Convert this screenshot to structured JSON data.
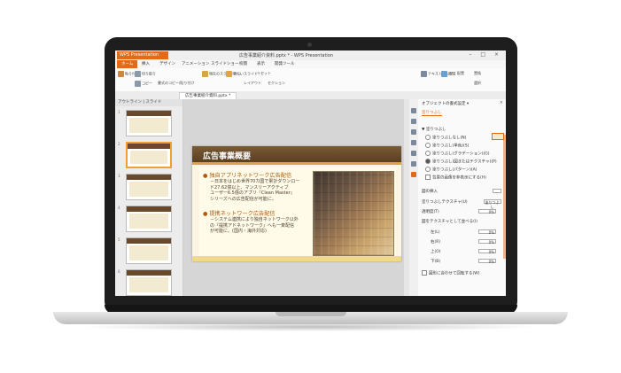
{
  "app": {
    "menu_button": "WPS Presentation",
    "doc_title": "広告事業紹介資料.pptx * - WPS Presentation",
    "window_controls": "– □ ×"
  },
  "menu": {
    "items": [
      "ホーム",
      "挿入",
      "デザイン",
      "アニメーション",
      "スライドショー",
      "校閲",
      "表示",
      "開発ツール"
    ],
    "active_index": 0
  },
  "ribbon": {
    "buttons": [
      "貼り付け",
      "切り取り",
      "コピー",
      "書式のコピー/貼り付け",
      "現在のスライドから",
      "新しいスライド",
      "レイアウト",
      "リセット",
      "セクション",
      "テキストボックス",
      "図形",
      "配置",
      "置換",
      "選択"
    ]
  },
  "tabbar": {
    "doc_tab": "広告事業紹介資料.pptx *"
  },
  "left_pane": {
    "tabs": "アウトライン | スライド",
    "slide_numbers": [
      "1",
      "2",
      "3",
      "4",
      "5",
      "6"
    ],
    "selected_index": 1
  },
  "slide": {
    "title": "広告事業概要",
    "bullet1_head": "独自アプリネットワーク広告配信",
    "bullet1_text": [
      "－日本をはじめ世界70カ国で累計ダウンロー",
      "ド27.62億以上、マンスリーアクティブ",
      "ユーザー6.5億のアプリ『Clean Master』",
      "シリーズへの広告配信が可能に。"
    ],
    "bullet2_head": "提携ネットワーク広告配信",
    "bullet2_text": [
      "－システム連携により独自ネットワーク以外",
      "の『提携アドネットワーク』へも一斉配信",
      "が可能に。(国内・海外対応)"
    ]
  },
  "right_pane": {
    "title": "オブジェクトの書式設定 ▾",
    "close": "×",
    "tab": "塗りつぶし",
    "section": "▼ 塗りつぶし",
    "radios": [
      "塗りつぶしなし(N)",
      "塗りつぶし(単色)(S)",
      "塗りつぶし(グラデーション)(G)",
      "塗りつぶし(図またはテクスチャ)(P)",
      "塗りつぶし(パターン)(A)"
    ],
    "radio_selected_index": 3,
    "hide_bg": "背景の画像を非表示にする(H)",
    "insert_label": "図の挿入",
    "insert_btn": "…",
    "texture": "塗りつぶしテクスチャ(U)",
    "texture_btn": "塗りつぶし",
    "transparency": "透明度(T)",
    "transparency_val": "0%",
    "tile_label": "図をテクスチャとして並べる(I)",
    "offsets": [
      {
        "label": "左(L)",
        "value": "0%"
      },
      {
        "label": "右(R)",
        "value": "0%"
      },
      {
        "label": "上(O)",
        "value": "0%"
      },
      {
        "label": "下(B)",
        "value": "0%"
      }
    ],
    "rotate": "図形に合わせて回転する(W)"
  }
}
